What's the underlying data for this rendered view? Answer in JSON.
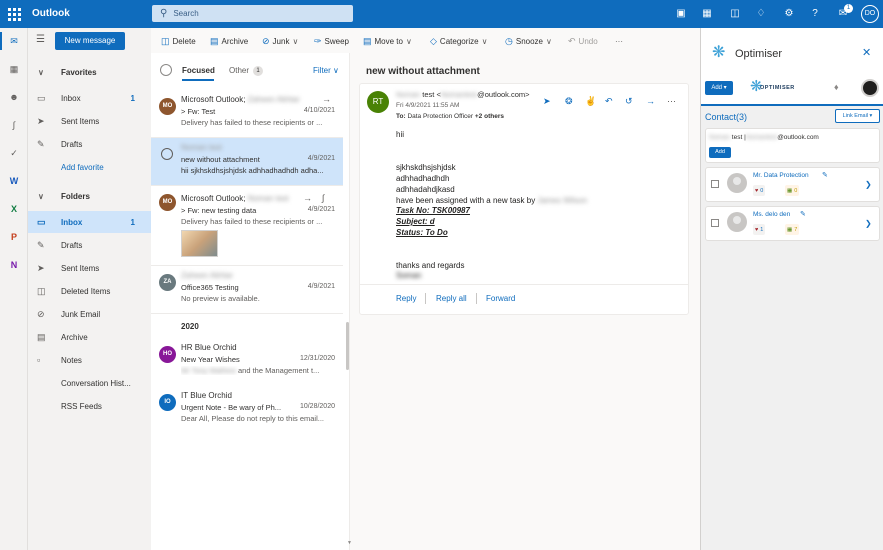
{
  "topbar": {
    "app_name": "Outlook",
    "search_placeholder": "Search",
    "notification_count": "1",
    "user_initials": "DO"
  },
  "toolbar": {
    "new_message": "New message",
    "delete": "Delete",
    "archive": "Archive",
    "junk": "Junk",
    "sweep": "Sweep",
    "move_to": "Move to",
    "categorize": "Categorize",
    "snooze": "Snooze",
    "undo": "Undo",
    "more": "···"
  },
  "favorites": {
    "header": "Favorites",
    "items": [
      {
        "label": "Inbox",
        "count": "1"
      },
      {
        "label": "Sent Items",
        "count": ""
      },
      {
        "label": "Drafts",
        "count": ""
      }
    ],
    "add_favorite": "Add favorite"
  },
  "folders": {
    "header": "Folders",
    "items": [
      {
        "label": "Inbox",
        "count": "1"
      },
      {
        "label": "Drafts",
        "count": ""
      },
      {
        "label": "Sent Items",
        "count": ""
      },
      {
        "label": "Deleted Items",
        "count": ""
      },
      {
        "label": "Junk Email",
        "count": ""
      },
      {
        "label": "Archive",
        "count": ""
      },
      {
        "label": "Notes",
        "count": ""
      },
      {
        "label": "Conversation Hist...",
        "count": ""
      },
      {
        "label": "RSS Feeds",
        "count": ""
      }
    ]
  },
  "list": {
    "tab_focused": "Focused",
    "tab_other": "Other",
    "other_count": "1",
    "filter": "Filter",
    "section_2020": "2020",
    "messages": [
      {
        "initials": "MO",
        "avatar_color": "#8e562e",
        "from": "Microsoft Outlook;",
        "from_hidden": "Zaheen Akhtar",
        "subject": "> Fw: Test",
        "preview": "Delivery has failed to these recipients or ...",
        "date": "4/10/2021"
      },
      {
        "initials": "",
        "avatar_color": "",
        "from": "",
        "from_hidden": "Noman test",
        "subject": "new without attachment",
        "preview": "hii sjkhskdhsjshjdsk adhhadhadhdh adha...",
        "date": "4/9/2021"
      },
      {
        "initials": "MO",
        "avatar_color": "#8e562e",
        "from": "Microsoft Outlook;",
        "from_hidden": "Noman test",
        "subject": "> Fw: new testing data",
        "preview": "Delivery has failed to these recipients or ...",
        "date": "4/9/2021"
      },
      {
        "initials": "ZA",
        "avatar_color": "#69797e",
        "from": "",
        "from_hidden": "Zaheen Akhtar",
        "subject": "Office365 Testing",
        "preview": "No preview is available.",
        "date": "4/9/2021"
      },
      {
        "initials": "HO",
        "avatar_color": "#881798",
        "from": "HR Blue Orchid",
        "from_hidden": "",
        "subject": "New Year Wishes",
        "preview": "and the Management t...",
        "preview_hidden": "Mr Tony Mathew",
        "date": "12/31/2020"
      },
      {
        "initials": "IO",
        "avatar_color": "#0f6cbd",
        "from": "IT Blue Orchid",
        "from_hidden": "",
        "subject": "Urgent Note - Be wary of Ph...",
        "preview": "Dear All, Please do not reply to this email...",
        "date": "10/28/2020"
      }
    ]
  },
  "reading": {
    "subject": "new without attachment",
    "sender_initials": "RT",
    "sender_name_hidden": "Noman",
    "sender_label": "test <",
    "sender_email_hidden": "Nomantest",
    "sender_email_domain": "@outlook.com>",
    "date": "Fri 4/9/2021 11:55 AM",
    "to_label": "To:",
    "to_value": "Data Protection Officer",
    "to_more": "+2 others",
    "body": {
      "greeting": "hii",
      "line1": "sjkhskdhsjshjdsk",
      "line2": "adhhadhadhdh",
      "line3": "adhhadahdjkasd",
      "line4": " have been assigned with a new task by",
      "line4_hidden": "James Wilson",
      "task_no": "Task No:  TSK00987",
      "subject_line": "Subject:  d",
      "status_line": "Status:  To Do",
      "closing": "thanks and regards",
      "signature_hidden": "Soman"
    },
    "reply": "Reply",
    "reply_all": "Reply all",
    "forward": "Forward"
  },
  "optimiser": {
    "title": "Optimiser",
    "add_button": "Add",
    "brand": "OPTIMISER",
    "contact_title": "Contact(3)",
    "link_email": "Link Email",
    "card1": {
      "name_hidden": "Noman",
      "text": "test |",
      "email_hidden": "Nomantest",
      "domain": "@outlook.com",
      "add": "Add"
    },
    "people": [
      {
        "name": "Mr. Data Protection",
        "hearts": "0",
        "cal": "0"
      },
      {
        "name": "Ms. delo den",
        "hearts": "1",
        "cal": "7"
      }
    ]
  }
}
